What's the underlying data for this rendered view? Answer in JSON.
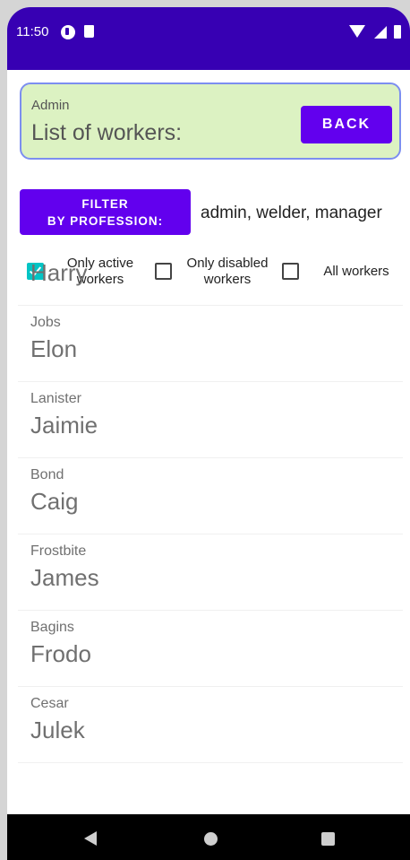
{
  "status_bar": {
    "time": "11:50",
    "icons": [
      "notification-app-icon",
      "sd-card-icon",
      "wifi-icon",
      "signal-icon",
      "battery-icon"
    ]
  },
  "header": {
    "role": "Admin",
    "title": "List of workers:",
    "back_label": "BACK"
  },
  "filter": {
    "button_line1": "FILTER",
    "button_line2": "BY PROFESSION:",
    "value": "admin, welder, manager"
  },
  "checkboxes": [
    {
      "line1": "Only active",
      "line2": "workers",
      "checked": true
    },
    {
      "line1": "Only disabled",
      "line2": "workers",
      "checked": false
    },
    {
      "line1": "All workers",
      "line2": "",
      "checked": false
    }
  ],
  "workers": [
    {
      "surname": "",
      "name": "Harry"
    },
    {
      "surname": "Jobs",
      "name": "Elon"
    },
    {
      "surname": "Lanister",
      "name": "Jaimie"
    },
    {
      "surname": "Bond",
      "name": "Caig"
    },
    {
      "surname": "Frostbite",
      "name": "James"
    },
    {
      "surname": "Bagins",
      "name": "Frodo"
    },
    {
      "surname": "Cesar",
      "name": "Julek"
    }
  ],
  "colors": {
    "status_bar": "#3700b3",
    "primary_button": "#6200ee",
    "header_card_bg": "#dcf2c2",
    "header_card_border": "#7c8ef0",
    "checkbox_checked": "#03c4c4"
  }
}
